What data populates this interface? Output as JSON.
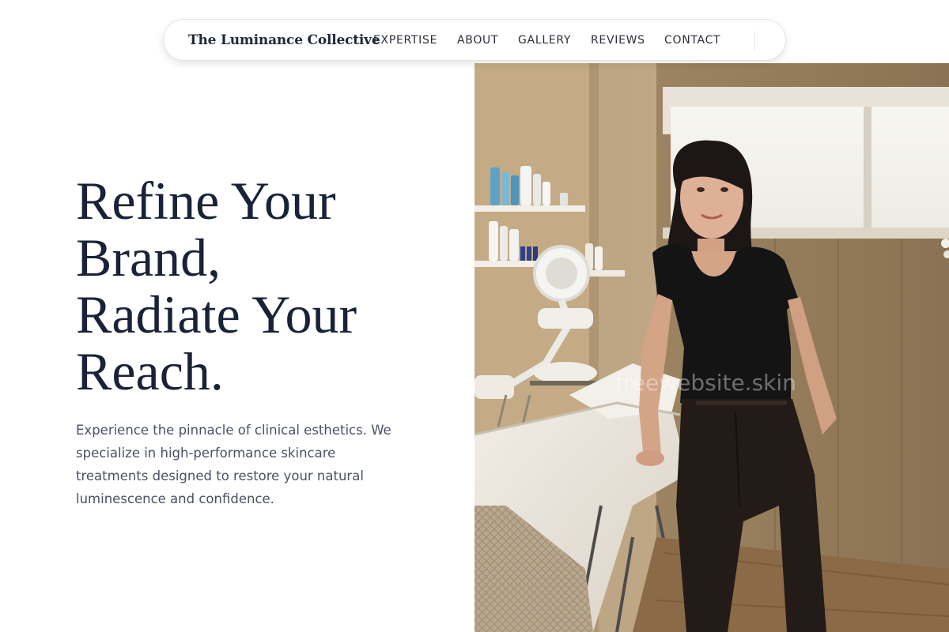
{
  "nav": {
    "brand": "The Luminance Collective",
    "links": [
      {
        "label": "EXPERTISE"
      },
      {
        "label": "ABOUT"
      },
      {
        "label": "GALLERY"
      },
      {
        "label": "REVIEWS"
      },
      {
        "label": "CONTACT"
      }
    ]
  },
  "hero": {
    "headline_lines": [
      "Refine Your",
      "Brand,",
      "Radiate Your",
      "Reach."
    ],
    "lead": "Experience the pinnacle of clinical esthetics. We specialize in high-performance skincare treatments designed to restore your natural luminescence and confidence."
  },
  "watermark": "freewebsite.skin"
}
